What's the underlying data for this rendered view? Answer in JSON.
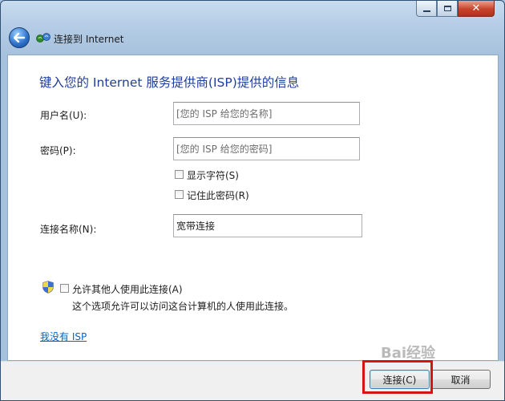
{
  "window": {
    "title": "连接到 Internet",
    "controls": {
      "minimize": "minimize-icon",
      "maximize": "maximize-icon",
      "close": "close-icon"
    }
  },
  "heading": "键入您的 Internet 服务提供商(ISP)提供的信息",
  "form": {
    "username_label": "用户名(U):",
    "username_placeholder": "[您的 ISP 给您的名称]",
    "password_label": "密码(P):",
    "password_placeholder": "[您的 ISP 给您的密码]",
    "show_chars_label": "显示字符(S)",
    "show_chars_checked": false,
    "remember_label": "记住此密码(R)",
    "remember_checked": false,
    "connection_name_label": "连接名称(N):",
    "connection_name_value": "宽带连接",
    "allow_others_label": "允许其他人使用此连接(A)",
    "allow_others_checked": false,
    "allow_others_desc": "这个选项允许可以访问这台计算机的人使用此连接。"
  },
  "no_isp_link": "我没有 ISP",
  "buttons": {
    "connect": "连接(C)",
    "cancel": "取消"
  },
  "watermark": "Bai经验",
  "colors": {
    "heading": "#1e3e9a",
    "link": "#0066cc",
    "highlight": "#d41515"
  }
}
